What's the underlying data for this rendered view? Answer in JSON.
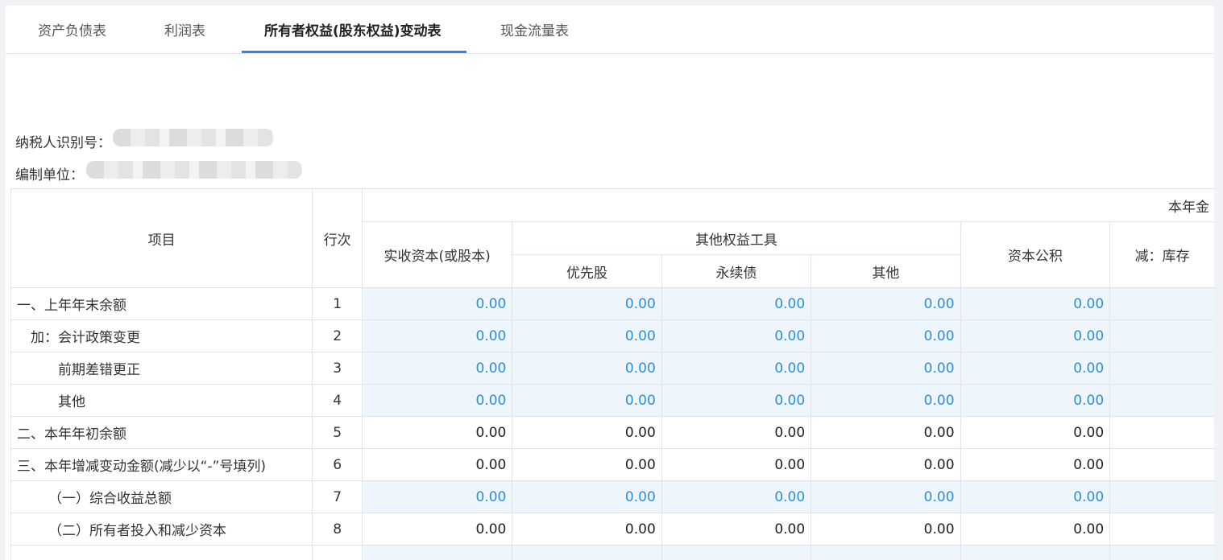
{
  "tabs": [
    {
      "label": "资产负债表",
      "active": false
    },
    {
      "label": "利润表",
      "active": false
    },
    {
      "label": "所有者权益(股东权益)变动表",
      "active": true
    },
    {
      "label": "现金流量表",
      "active": false
    }
  ],
  "info": {
    "taxpayer_id_label": "纳税人识别号：",
    "unit_label": "编制单位："
  },
  "table": {
    "col_item": "项目",
    "col_line": "行次",
    "group_current_year": "本年金",
    "col_paid_in_capital": "实收资本(或股本)",
    "group_other_equity": "其他权益工具",
    "col_preferred": "优先股",
    "col_perpetual": "永续债",
    "col_other": "其他",
    "col_capital_reserve": "资本公积",
    "col_treasury": "减：库存",
    "rows": [
      {
        "label": "一、上年年末余额",
        "line": "1",
        "values": [
          "0.00",
          "0.00",
          "0.00",
          "0.00",
          "0.00"
        ],
        "editable": true
      },
      {
        "label": "加：会计政策变更",
        "line": "2",
        "values": [
          "0.00",
          "0.00",
          "0.00",
          "0.00",
          "0.00"
        ],
        "editable": true
      },
      {
        "label": "前期差错更正",
        "line": "3",
        "values": [
          "0.00",
          "0.00",
          "0.00",
          "0.00",
          "0.00"
        ],
        "editable": true
      },
      {
        "label": "其他",
        "line": "4",
        "values": [
          "0.00",
          "0.00",
          "0.00",
          "0.00",
          "0.00"
        ],
        "editable": true
      },
      {
        "label": "二、本年年初余额",
        "line": "5",
        "values": [
          "0.00",
          "0.00",
          "0.00",
          "0.00",
          "0.00"
        ],
        "editable": false
      },
      {
        "label": "三、本年增减变动金额(减少以“-”号填列)",
        "line": "6",
        "values": [
          "0.00",
          "0.00",
          "0.00",
          "0.00",
          "0.00"
        ],
        "editable": false
      },
      {
        "label": "（一）综合收益总额",
        "line": "7",
        "values": [
          "0.00",
          "0.00",
          "0.00",
          "0.00",
          "0.00"
        ],
        "editable": true
      },
      {
        "label": "（二）所有者投入和减少资本",
        "line": "8",
        "values": [
          "0.00",
          "0.00",
          "0.00",
          "0.00",
          "0.00"
        ],
        "editable": false
      }
    ]
  }
}
